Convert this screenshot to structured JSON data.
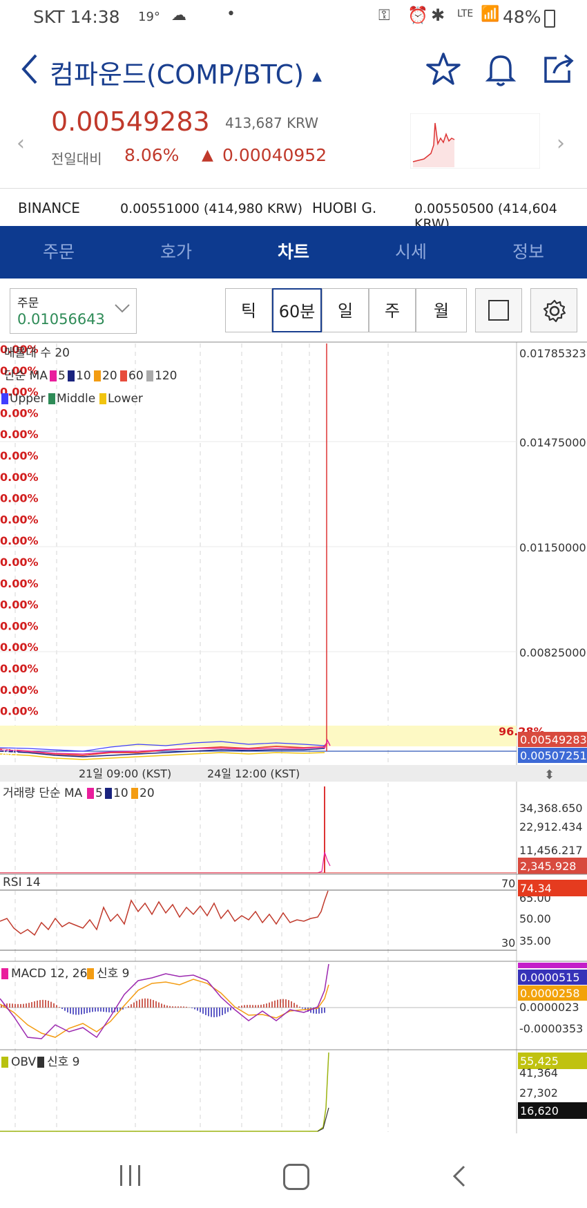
{
  "status_bar": {
    "carrier_time": "SKT 14:38",
    "temperature": "19°",
    "network": "LTE",
    "battery": "48%"
  },
  "header": {
    "title": "컴파운드(COMP/BTC)"
  },
  "price": {
    "current": "0.00549283",
    "krw": "413,687 KRW",
    "change_label": "전일대비",
    "change_pct": "8.06%",
    "change_amount": "0.00040952"
  },
  "exchanges": [
    {
      "name": "BINANCE",
      "value": "0.00551000 (414,980 KRW)"
    },
    {
      "name": "HUOBI G.",
      "value": "0.00550500 (414,604 KRW)"
    }
  ],
  "tabs": [
    {
      "label": "주문",
      "active": false
    },
    {
      "label": "호가",
      "active": false
    },
    {
      "label": "차트",
      "active": true
    },
    {
      "label": "시세",
      "active": false
    },
    {
      "label": "정보",
      "active": false
    }
  ],
  "controls": {
    "order_label": "주문",
    "order_value": "0.01056643",
    "periods": [
      {
        "label": "틱",
        "active": false
      },
      {
        "label": "60분",
        "active": true
      },
      {
        "label": "일",
        "active": false
      },
      {
        "label": "주",
        "active": false
      },
      {
        "label": "월",
        "active": false
      }
    ]
  },
  "chart": {
    "pct_label": "0.00%",
    "indicators_line1": "매물대 수 20",
    "indicators_line2_prefix": "단순 MA",
    "ma_periods": [
      "5",
      "10",
      "20",
      "60",
      "120"
    ],
    "bb_labels": [
      "Upper",
      "Middle",
      "Lower"
    ],
    "price_axis": [
      "0.01785323",
      "0.01475000",
      "0.01150000",
      "0.00825000"
    ],
    "current_price_tag": "0.00549283",
    "low_price_tag": "0.00507251",
    "high_pct": "96.28%",
    "low_tag": "저가",
    "time_labels": [
      "21일 09:00 (KST)",
      "24일 12:00 (KST)"
    ],
    "volume_label": "거래량 단순 MA",
    "volume_ma": [
      "5",
      "10",
      "20"
    ],
    "volume_axis": [
      "34,368.650",
      "22,912.434",
      "11,456.217"
    ],
    "volume_tag": "2,345.928",
    "rsi_label": "RSI 14",
    "rsi_levels": [
      "70",
      "30"
    ],
    "rsi_axis": [
      "65.00",
      "50.00",
      "35.00"
    ],
    "rsi_tag": "74.34",
    "macd_label": "MACD 12, 26",
    "macd_signal_label": "신호 9",
    "macd_tags": [
      "0.0000515",
      "0.0000258"
    ],
    "macd_axis": [
      "0.0000023",
      "-0.0000353"
    ],
    "obv_label": "OBV",
    "obv_signal_label": "신호 9",
    "obv_tag": "55,425",
    "obv_axis": [
      "41,364",
      "27,302"
    ],
    "obv_tag2": "16,620"
  },
  "colors": {
    "brand_blue": "#0d3a8f",
    "price_red": "#c0392b",
    "order_green": "#2e8b57"
  }
}
